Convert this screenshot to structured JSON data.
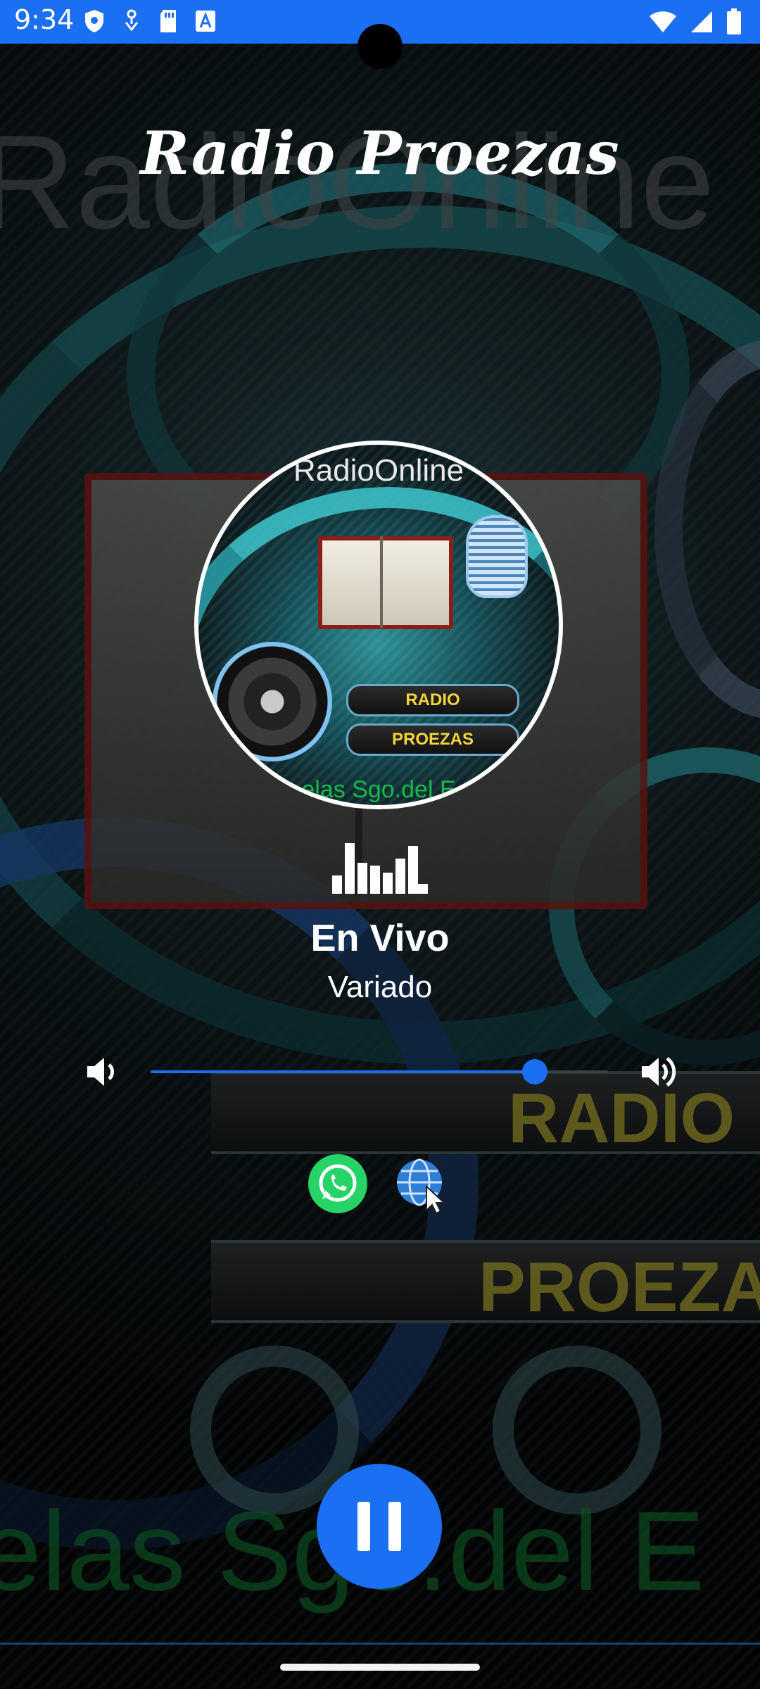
{
  "status_bar": {
    "time": "9:34",
    "left_icons": [
      "shield-icon",
      "location-icon",
      "sd-card-icon",
      "font-icon"
    ],
    "right_icons": [
      "wifi-icon",
      "signal-icon",
      "battery-icon"
    ],
    "background_color": "#1a6ff2"
  },
  "app": {
    "title": "Radio Proezas",
    "accent_color": "#1a6ff2"
  },
  "station_logo": {
    "top_text": "RadioOnline",
    "plate_1": "RADIO",
    "plate_2": "PROEZAS",
    "bottom_text": "elas Sgo.del E"
  },
  "now_playing": {
    "equalizer_icon": "equalizer-icon",
    "title": "En Vivo",
    "subtitle": "Variado"
  },
  "volume": {
    "level": 0.84,
    "low_icon": "volume-low-icon",
    "high_icon": "volume-high-icon"
  },
  "social": {
    "whatsapp_icon": "whatsapp-icon",
    "website_icon": "globe-cursor-icon",
    "whatsapp_color": "#25d366"
  },
  "player": {
    "state": "playing",
    "control_icon": "pause-icon"
  },
  "background_wordmarks": {
    "radio_online": "RadioOnline",
    "radio": "RADIO",
    "proezas": "PROEZA",
    "footer": "elas Sgo.del E"
  }
}
